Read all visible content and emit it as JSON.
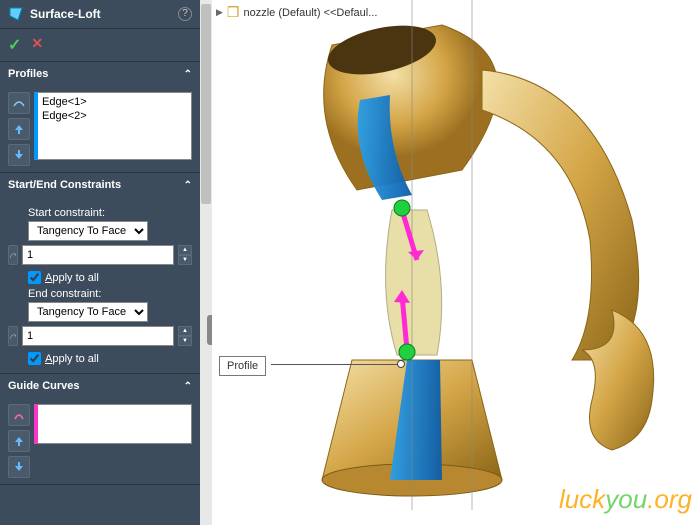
{
  "panel": {
    "title": "Surface-Loft",
    "help": "?"
  },
  "confirm": {
    "ok": "✓",
    "cancel": "✕"
  },
  "profiles": {
    "header": "Profiles",
    "items": [
      "Edge<1>",
      "Edge<2>"
    ]
  },
  "constraints": {
    "header": "Start/End Constraints",
    "start_label": "Start constraint:",
    "start_value": "Tangency To Face",
    "start_spin": "1",
    "start_apply": "Apply to all",
    "start_apply_accessA": "A",
    "end_label": "End constraint:",
    "end_value": "Tangency To Face",
    "end_spin": "1",
    "end_apply": "Apply to all",
    "end_apply_accessA": "A"
  },
  "guide": {
    "header": "Guide Curves"
  },
  "breadcrumb": {
    "item": "nozzle (Default) <<Defaul..."
  },
  "callout": "Profile",
  "watermark": {
    "a": "luck",
    "b": "you",
    "c": ".org"
  }
}
